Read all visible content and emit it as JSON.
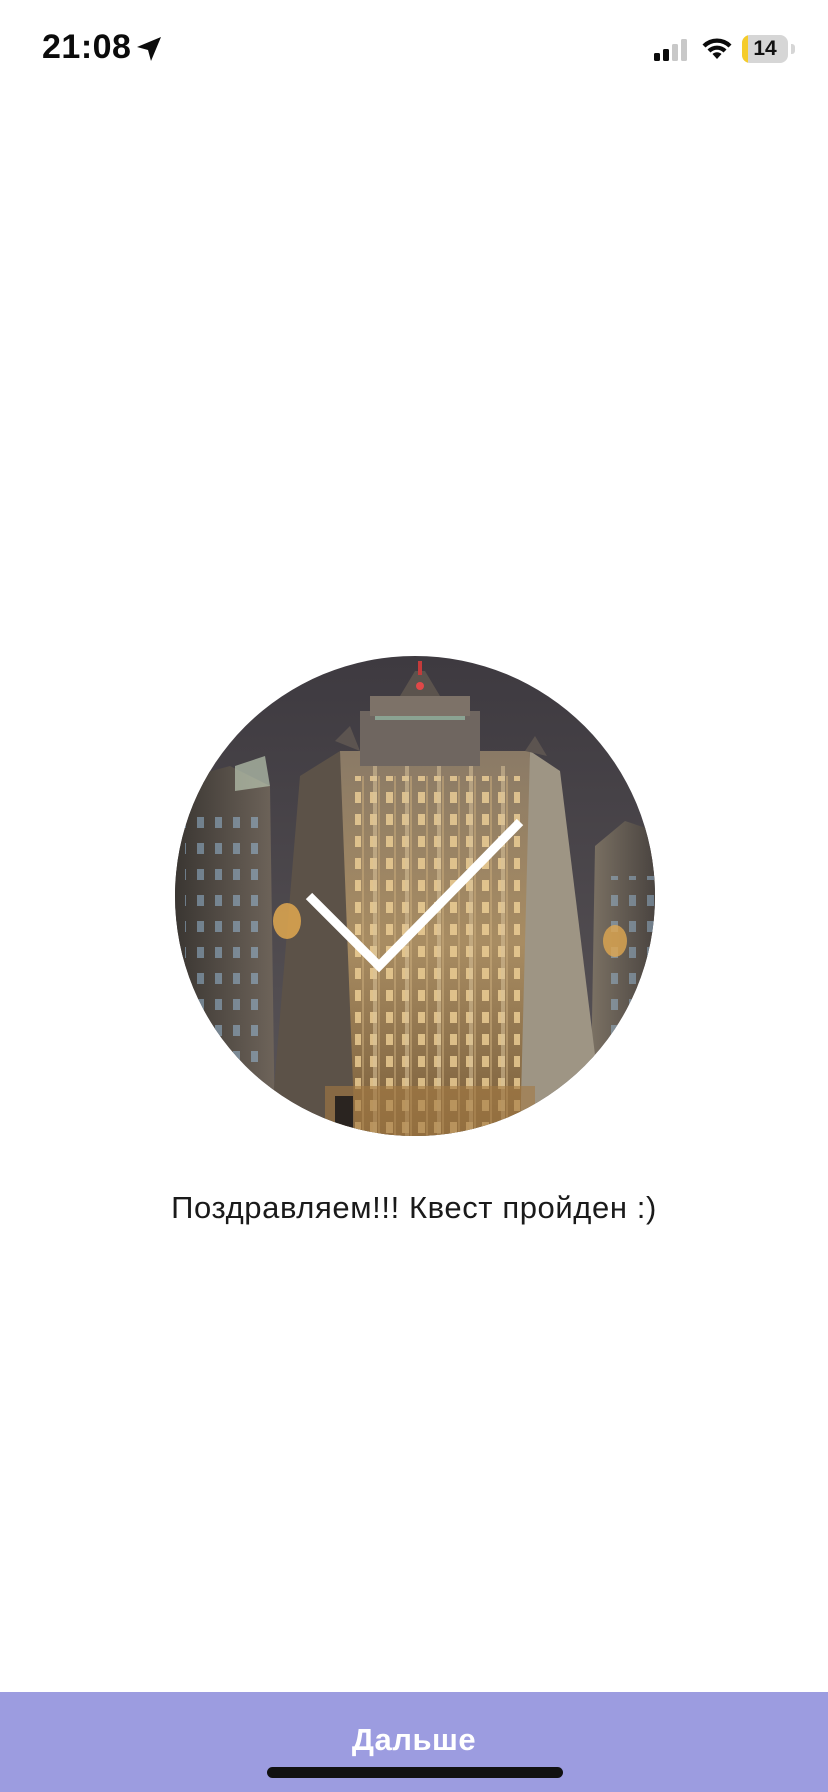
{
  "status_bar": {
    "time": "21:08",
    "battery_level": "14",
    "battery_fraction": 0.14,
    "icons": [
      "location-arrow-icon",
      "cellular-signal-icon",
      "wifi-icon",
      "battery-icon"
    ]
  },
  "main": {
    "image_icon": "checkmark-icon",
    "message": "Поздравляем!!! Квест пройден :)"
  },
  "footer": {
    "next_label": "Дальше"
  },
  "colors": {
    "button_background": "#9c9ce0",
    "button_text": "#ffffff",
    "battery_fill": "#f5cc2b",
    "page_background": "#ffffff"
  }
}
